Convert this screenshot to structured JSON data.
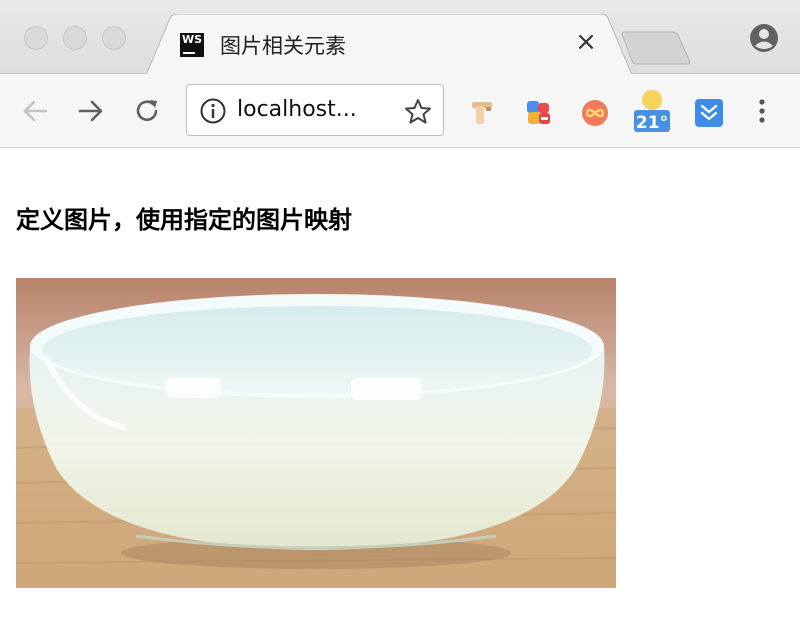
{
  "browser": {
    "tab": {
      "title": "图片相关元素",
      "favicon_text": "WS",
      "close_glyph": "×"
    },
    "address_bar": {
      "url": "localhost..."
    },
    "extensions": {
      "weather_temp": "21°"
    }
  },
  "page": {
    "heading": "定义图片，使用指定的图片映射"
  },
  "icons": [
    "back-arrow-icon",
    "forward-arrow-icon",
    "reload-icon",
    "info-icon",
    "star-icon",
    "profile-icon",
    "overflow-menu-icon"
  ],
  "colors": {
    "tabstrip": "#dedede",
    "toolbar": "#f6f6f6",
    "weather_badge": "#4a90e2"
  }
}
